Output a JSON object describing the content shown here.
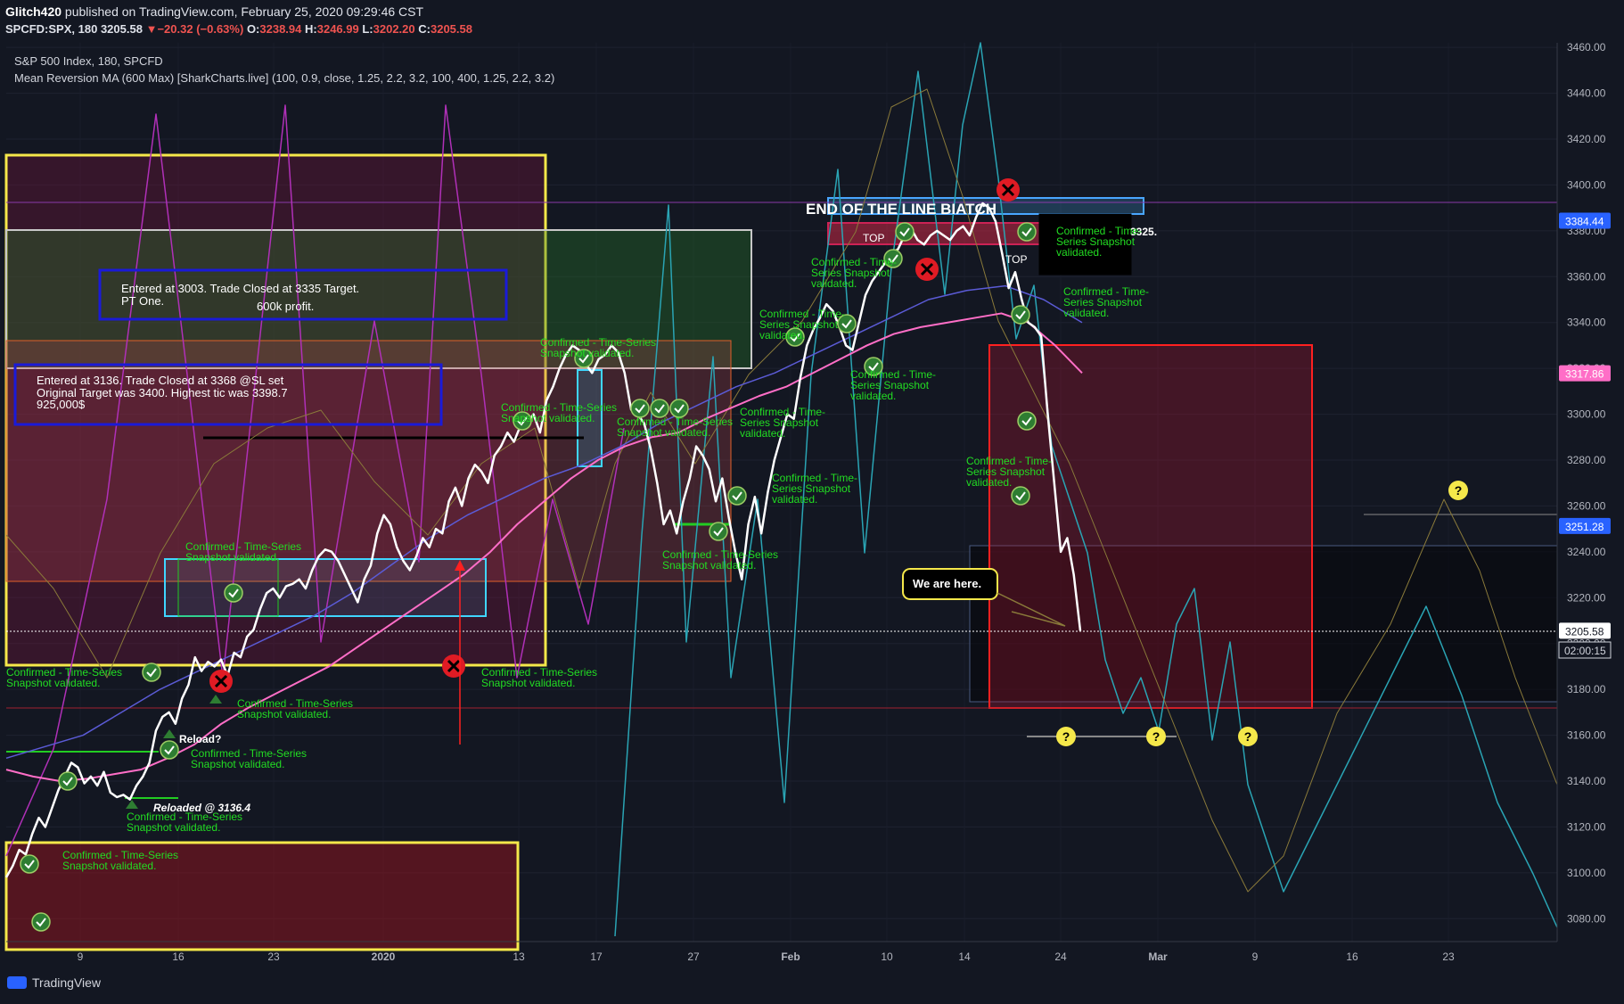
{
  "header": {
    "author": "Glitch420",
    "published": " published on TradingView.com, February 25, 2020 09:29:46 CST",
    "symbol": "SPCFD:SPX, 180",
    "last": "3205.58",
    "change": "−20.32 (−0.63%)",
    "o_label": "O:",
    "o": "3238.94",
    "h_label": "H:",
    "h": "3246.99",
    "l_label": "L:",
    "l": "3202.20",
    "c_label": "C:",
    "c": "3205.58"
  },
  "chart_title": "S&P 500 Index, 180, SPCFD",
  "indicator_title": "Mean Reversion MA (600 Max) [SharkCharts.live] (100, 0.9, close, 1.25, 2.2, 3.2, 100, 400, 1.25, 2.2, 3.2)",
  "footer": {
    "brand": "TradingView"
  },
  "colors": {
    "background": "#131722",
    "price": "#ffffff",
    "ma_pink": "#ff6ec7",
    "ma_blue": "#5b5bd6",
    "cyan": "#2aa4b4",
    "magenta": "#b030b8",
    "olive": "#8a7a3a",
    "confirm_green": "#22dd22"
  },
  "chart_data": {
    "type": "line",
    "y_range": [
      3070,
      3462
    ],
    "y_ticks": [
      3080,
      3100,
      3120,
      3140,
      3160,
      3180,
      3200,
      3220,
      3240,
      3260,
      3280,
      3300,
      3320,
      3340,
      3360,
      3380,
      3400,
      3420,
      3440,
      3460
    ],
    "y_tick_labels": [
      "3080.00",
      "3100.00",
      "3120.00",
      "3140.00",
      "3160.00",
      "3180.00",
      "3200.00",
      "3220.00",
      "3240.00",
      "3260.00",
      "3280.00",
      "3300.00",
      "3320.00",
      "3340.00",
      "3360.00",
      "3380.00",
      "3400.00",
      "3420.00",
      "3440.00",
      "3460.00"
    ],
    "x_ticks": [
      "9",
      "16",
      "23",
      "2020",
      "13",
      "17",
      "27",
      "Feb",
      "10",
      "14",
      "24",
      "Mar",
      "9",
      "16",
      "23"
    ],
    "price_badges": [
      {
        "label": "3384.44",
        "value": 3384.44,
        "color": "#2962ff"
      },
      {
        "label": "3317.86",
        "value": 3317.86,
        "color": "#ff6ec7"
      },
      {
        "label": "3251.28",
        "value": 3251.28,
        "color": "#2962ff"
      },
      {
        "label": "3205.58",
        "value": 3205.58,
        "color": "#ffffff"
      }
    ],
    "countdown": "02:00:15",
    "series": [
      {
        "values": [
          3098,
          3103,
          3110,
          3108,
          3117,
          3124,
          3120,
          3128,
          3136,
          3142,
          3148,
          3146,
          3139,
          3142,
          3138,
          3144,
          3135,
          3133,
          3134,
          3132,
          3138,
          3142,
          3148,
          3162,
          3168,
          3170,
          3165,
          3176,
          3182,
          3194,
          3188,
          3192,
          3190,
          3193,
          3186,
          3196,
          3194,
          3203,
          3206,
          3215,
          3222,
          3224,
          3220,
          3225,
          3226,
          3228,
          3224,
          3232,
          3238,
          3241,
          3240,
          3236,
          3230,
          3224,
          3218,
          3228,
          3234,
          3248,
          3256,
          3252,
          3242,
          3236,
          3232,
          3238,
          3246,
          3242,
          3250,
          3248,
          3262,
          3268,
          3260,
          3272,
          3278,
          3275,
          3270,
          3282,
          3286,
          3292,
          3288,
          3295,
          3296,
          3300,
          3292,
          3306,
          3312,
          3320,
          3326,
          3330,
          3328,
          3322,
          3318,
          3324,
          3326,
          3330,
          3327,
          3318,
          3302,
          3300,
          3296,
          3285,
          3270,
          3252,
          3258,
          3248,
          3262,
          3272,
          3286,
          3282,
          3276,
          3262,
          3272,
          3255,
          3240,
          3228,
          3252,
          3264,
          3248,
          3266,
          3280,
          3290,
          3300,
          3298,
          3316,
          3330,
          3337,
          3342,
          3348,
          3345,
          3338,
          3330,
          3328,
          3340,
          3352,
          3358,
          3362,
          3366,
          3370,
          3372,
          3378,
          3381,
          3376,
          3374,
          3378,
          3380,
          3378,
          3376,
          3380,
          3382,
          3378,
          3386,
          3392,
          3390,
          3384,
          3370,
          3355,
          3362,
          3350,
          3340,
          3338,
          3334,
          3300,
          3270,
          3240,
          3246,
          3230,
          3205.58
        ]
      },
      {
        "values": [
          3145,
          3142,
          3140,
          3141,
          3143,
          3145,
          3150,
          3156,
          3165,
          3172,
          3178,
          3184,
          3190,
          3198,
          3206,
          3214,
          3222,
          3230,
          3240,
          3252,
          3262,
          3272,
          3280,
          3286,
          3290,
          3292,
          3298,
          3303,
          3308,
          3312,
          3318,
          3324,
          3330,
          3335,
          3338,
          3340,
          3342,
          3344,
          3340,
          3330,
          3318
        ]
      },
      {
        "values": [
          3150,
          3155,
          3160,
          3170,
          3180,
          3188,
          3196,
          3204,
          3212,
          3222,
          3234,
          3246,
          3256,
          3264,
          3272,
          3278,
          3286,
          3296,
          3304,
          3312,
          3318,
          3326,
          3334,
          3342,
          3350,
          3354,
          3356,
          3350,
          3340
        ]
      }
    ],
    "annotations": [
      {
        "text": "Entered at 3003. Trade Closed  at 3335 Target."
      },
      {
        "text": "PT One."
      },
      {
        "text": "600k profit."
      },
      {
        "text": "Entered at 3136. Trade Closed at 3368 @SL  set"
      },
      {
        "text": "Original Target was 3400. Highest tic was 3398.7"
      },
      {
        "text": "925,000$"
      },
      {
        "text": "END OF THE LINE BIATCH"
      },
      {
        "text": "We are here."
      },
      {
        "text": "Reload?"
      },
      {
        "text": "Reloaded @ 3136.4"
      },
      {
        "text": "TOP"
      },
      {
        "text": "3325."
      },
      {
        "text": "?"
      }
    ],
    "confirm_label_line1": "Confirmed - Time-Series",
    "confirm_label_line2": "Snapshot validated.",
    "confirm_label_a": "Confirmed - Time-",
    "confirm_label_b": "Series Snapshot",
    "confirm_label_c": "validated."
  }
}
